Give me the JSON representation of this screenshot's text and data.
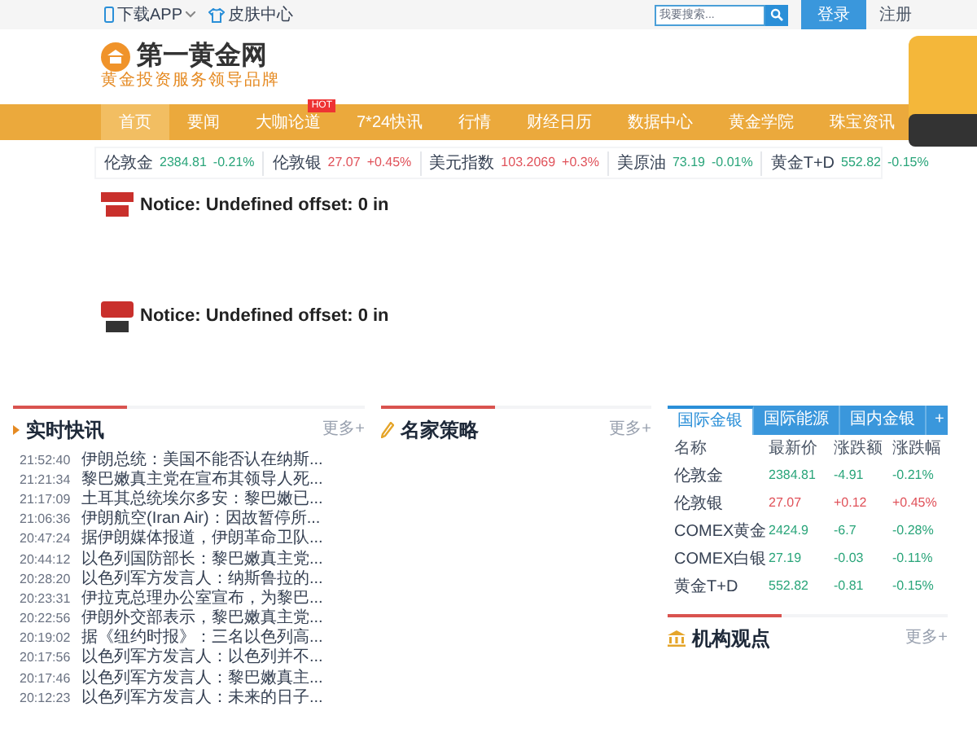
{
  "topbar": {
    "download": "下载APP",
    "skin": "皮肤中心",
    "search_placeholder": "我要搜索...",
    "login": "登录",
    "register": "注册"
  },
  "logo": {
    "name": "第一黄金网",
    "slogan": "黄金投资服务领导品牌"
  },
  "nav": [
    {
      "label": "首页",
      "selected": true,
      "hot": false
    },
    {
      "label": "要闻",
      "selected": false,
      "hot": false
    },
    {
      "label": "大咖论道",
      "selected": false,
      "hot": true
    },
    {
      "label": "7*24快讯",
      "selected": false,
      "hot": false
    },
    {
      "label": "行情",
      "selected": false,
      "hot": false
    },
    {
      "label": "财经日历",
      "selected": false,
      "hot": false
    },
    {
      "label": "数据中心",
      "selected": false,
      "hot": false
    },
    {
      "label": "黄金学院",
      "selected": false,
      "hot": false
    },
    {
      "label": "珠宝资讯",
      "selected": false,
      "hot": false
    }
  ],
  "hot_badge": "HOT",
  "ticker": [
    {
      "name": "伦敦金",
      "price": "2384.81",
      "change": "-0.21%",
      "color": "#2aa57a"
    },
    {
      "name": "伦敦银",
      "price": "27.07",
      "change": "+0.45%",
      "color": "#e0525a"
    },
    {
      "name": "美元指数",
      "price": "103.2069",
      "change": "+0.3%",
      "color": "#e0525a"
    },
    {
      "name": "美原油",
      "price": "73.19",
      "change": "-0.01%",
      "color": "#2aa57a"
    },
    {
      "name": "黄金T+D",
      "price": "552.82",
      "change": "-0.15%",
      "color": "#2aa57a"
    }
  ],
  "notices": [
    {
      "kind": "headline",
      "text": "Notice: Undefined offset: 0 in"
    },
    {
      "kind": "gold",
      "text": "Notice: Undefined offset: 0 in"
    }
  ],
  "flash": {
    "title": "实时快讯",
    "more": "更多+",
    "items": [
      {
        "time": "21:52:40",
        "text": "伊朗总统：美国不能否认在纳斯..."
      },
      {
        "time": "21:21:34",
        "text": "黎巴嫩真主党在宣布其领导人死..."
      },
      {
        "time": "21:17:09",
        "text": "土耳其总统埃尔多安：黎巴嫩已..."
      },
      {
        "time": "21:06:36",
        "text": "伊朗航空(Iran Air)：因故暂停所..."
      },
      {
        "time": "20:47:24",
        "text": "据伊朗媒体报道，伊朗革命卫队..."
      },
      {
        "time": "20:44:12",
        "text": "以色列国防部长：黎巴嫩真主党..."
      },
      {
        "time": "20:28:20",
        "text": "以色列军方发言人：纳斯鲁拉的..."
      },
      {
        "time": "20:23:31",
        "text": "伊拉克总理办公室宣布，为黎巴..."
      },
      {
        "time": "20:22:56",
        "text": "伊朗外交部表示，黎巴嫩真主党..."
      },
      {
        "time": "20:19:02",
        "text": "据《纽约时报》：三名以色列高..."
      },
      {
        "time": "20:17:56",
        "text": "以色列军方发言人：以色列并不..."
      },
      {
        "time": "20:17:46",
        "text": "以色列军方发言人：黎巴嫩真主..."
      },
      {
        "time": "20:12:23",
        "text": "以色列军方发言人：未来的日子..."
      }
    ]
  },
  "strategy": {
    "title": "名家策略",
    "more": "更多+"
  },
  "quotes": {
    "tabs": [
      {
        "label": "国际金银",
        "selected": true
      },
      {
        "label": "国际能源",
        "selected": false
      },
      {
        "label": "国内金银",
        "selected": false
      }
    ],
    "add": "+",
    "columns": [
      "名称",
      "最新价",
      "涨跌额",
      "涨跌幅"
    ],
    "rows": [
      {
        "name": "伦敦金",
        "price": "2384.81",
        "change": "-4.91",
        "percent": "-0.21%",
        "color": "#2aa57a"
      },
      {
        "name": "伦敦银",
        "price": "27.07",
        "change": "+0.12",
        "percent": "+0.45%",
        "color": "#e0525a"
      },
      {
        "name": "COMEX黄金",
        "price": "2424.9",
        "change": "-6.7",
        "percent": "-0.28%",
        "color": "#2aa57a"
      },
      {
        "name": "COMEX白银",
        "price": "27.19",
        "change": "-0.03",
        "percent": "-0.11%",
        "color": "#2aa57a"
      },
      {
        "name": "黄金T+D",
        "price": "552.82",
        "change": "-0.81",
        "percent": "-0.15%",
        "color": "#2aa57a"
      }
    ]
  },
  "institution": {
    "title": "机构观点",
    "more": "更多+"
  }
}
